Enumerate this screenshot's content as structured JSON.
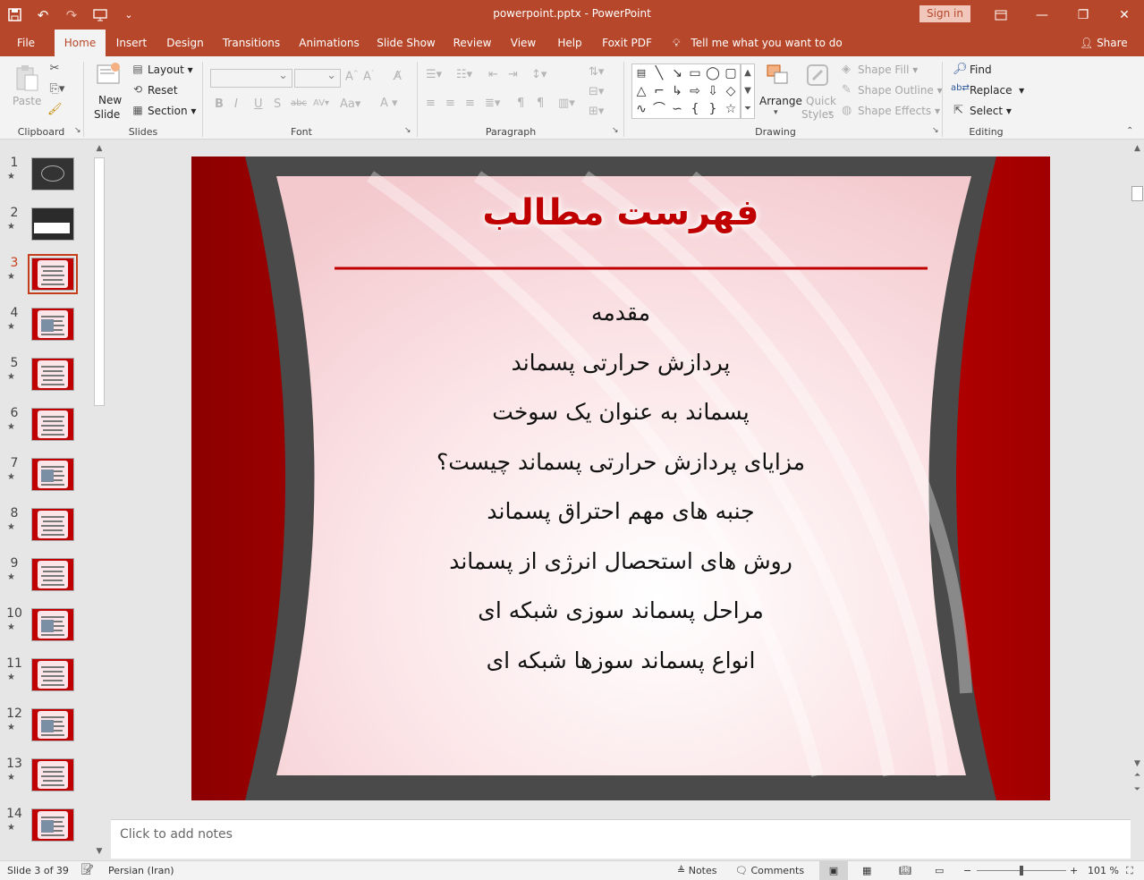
{
  "window": {
    "title": "powerpoint.pptx  -  PowerPoint",
    "sign_in": "Sign in"
  },
  "qat_icons": [
    "save-icon",
    "undo-icon",
    "redo-icon",
    "present-from-start-icon",
    "customize-qat-icon"
  ],
  "tabs": [
    {
      "label": "File"
    },
    {
      "label": "Home"
    },
    {
      "label": "Insert"
    },
    {
      "label": "Design"
    },
    {
      "label": "Transitions"
    },
    {
      "label": "Animations"
    },
    {
      "label": "Slide Show"
    },
    {
      "label": "Review"
    },
    {
      "label": "View"
    },
    {
      "label": "Help"
    },
    {
      "label": "Foxit PDF"
    }
  ],
  "tell_me": "Tell me what you want to do",
  "share": "Share",
  "ribbon": {
    "groups": {
      "clipboard": "Clipboard",
      "slides": "Slides",
      "font": "Font",
      "paragraph": "Paragraph",
      "drawing": "Drawing",
      "editing": "Editing"
    },
    "paste": "Paste",
    "new_slide_1": "New",
    "new_slide_2": "Slide",
    "layout": "Layout",
    "reset": "Reset",
    "section": "Section",
    "arrange": "Arrange",
    "quick_styles_1": "Quick",
    "quick_styles_2": "Styles",
    "shape_fill": "Shape Fill",
    "shape_outline": "Shape Outline",
    "shape_effects": "Shape Effects",
    "find": "Find",
    "replace": "Replace",
    "select": "Select"
  },
  "thumbnails": [
    {
      "num": "1",
      "star": "★"
    },
    {
      "num": "2",
      "star": "★"
    },
    {
      "num": "3",
      "star": "★"
    },
    {
      "num": "4",
      "star": "★"
    },
    {
      "num": "5",
      "star": "★"
    },
    {
      "num": "6",
      "star": "★"
    },
    {
      "num": "7",
      "star": "★"
    },
    {
      "num": "8",
      "star": "★"
    },
    {
      "num": "9",
      "star": "★"
    },
    {
      "num": "10",
      "star": "★"
    },
    {
      "num": "11",
      "star": "★"
    },
    {
      "num": "12",
      "star": "★"
    },
    {
      "num": "13",
      "star": "★"
    },
    {
      "num": "14",
      "star": "★"
    }
  ],
  "selected_slide": "3",
  "slide": {
    "title": "فهرست مطالب",
    "items": [
      "مقدمه",
      "پردازش حرارتی پسماند",
      "پسماند به عنوان یک سوخت",
      "مزایای پردازش حرارتی پسماند چیست؟",
      "جنبه های مهم احتراق پسماند",
      "روش های استحصال انرژی از پسماند",
      "مراحل پسماند سوزی شبکه ای",
      "انواع پسماند سوزها شبکه  ای"
    ],
    "colors": {
      "frame": "#c00000",
      "title": "#c00000",
      "inner": "#4a4a4a"
    }
  },
  "notes_placeholder": "Click to add notes",
  "status": {
    "slide_info": "Slide 3 of 39",
    "language": "Persian (Iran)",
    "notes": "Notes",
    "comments": "Comments",
    "zoom": "101 %",
    "zoom_value": 101
  }
}
